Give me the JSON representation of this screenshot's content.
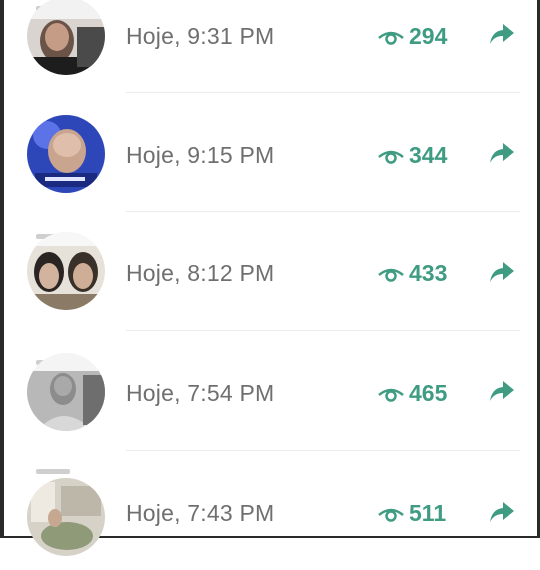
{
  "colors": {
    "accent": "#3f9c83",
    "time_text": "#6f6f6f"
  },
  "icons": {
    "views": "eye-icon",
    "share": "share-arrow-icon"
  },
  "items": [
    {
      "time": "Hoje, 9:31 PM",
      "views": "294"
    },
    {
      "time": "Hoje, 9:15 PM",
      "views": "344"
    },
    {
      "time": "Hoje, 8:12 PM",
      "views": "433"
    },
    {
      "time": "Hoje, 7:54 PM",
      "views": "465"
    },
    {
      "time": "Hoje, 7:43 PM",
      "views": "511"
    }
  ]
}
